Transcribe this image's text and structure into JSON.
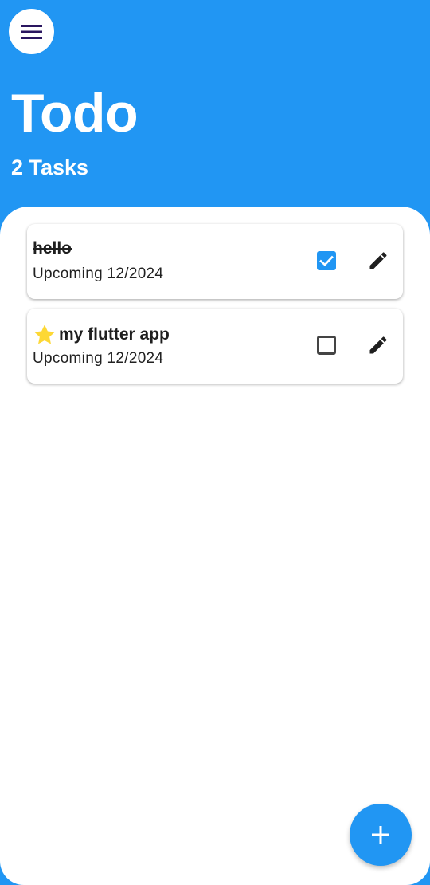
{
  "header": {
    "title": "Todo",
    "task_count": "2 Tasks",
    "menu_icon": "menu-icon"
  },
  "tasks": [
    {
      "title": "hello",
      "subtitle": "Upcoming 12/2024",
      "completed": true,
      "starred": false,
      "edit_icon": "pencil-icon"
    },
    {
      "title": "my flutter app",
      "subtitle": "Upcoming 12/2024",
      "completed": false,
      "starred": true,
      "edit_icon": "pencil-icon"
    }
  ],
  "fab": {
    "icon": "plus-icon"
  },
  "colors": {
    "primary": "#2196F3",
    "menu_icon": "#2A1660",
    "star": "#FDD835",
    "text": "#212121",
    "background": "#FFFFFF"
  }
}
